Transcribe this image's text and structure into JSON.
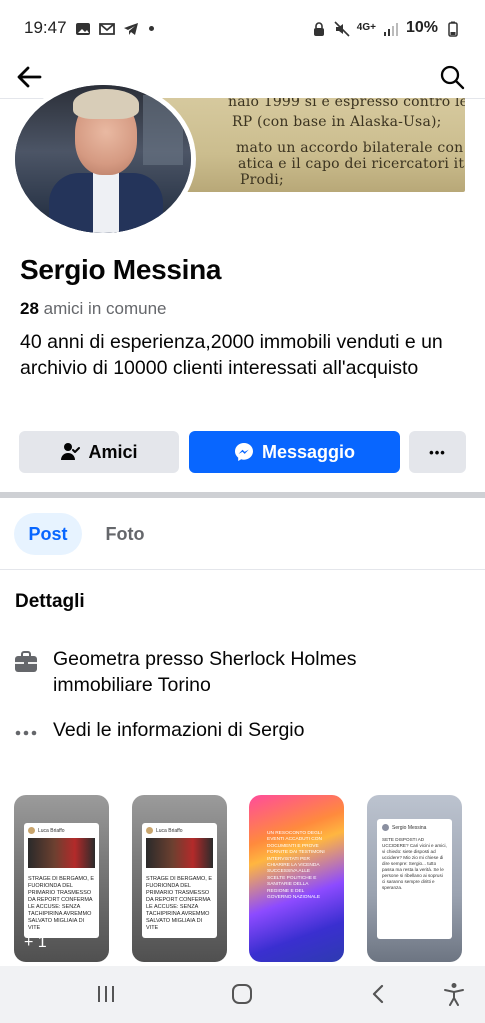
{
  "status_bar": {
    "time": "19:47",
    "network": "4G+",
    "battery": "10%"
  },
  "cover": {
    "lines": [
      "naio 1999 si è espresso contro le",
      "RP (con base in Alaska-Usa);",
      "mato un accordo bilaterale con gli",
      "atica e il capo dei ricercatori italiani",
      "Prodi;"
    ]
  },
  "profile": {
    "name": "Sergio Messina",
    "mutual_count": "28",
    "mutual_label": "amici in comune",
    "bio": "40 anni di esperienza,2000 immobili venduti e un archivio di 10000 clienti interessati all'acquisto"
  },
  "actions": {
    "friends_label": "Amici",
    "message_label": "Messaggio",
    "more_label": "•••"
  },
  "tabs": {
    "post": "Post",
    "photos": "Foto"
  },
  "details": {
    "title": "Dettagli",
    "work": "Geometra presso Sherlock Holmes immobiliare Torino",
    "info": "Vedi le informazioni di Sergio"
  },
  "thumbnails": {
    "card_author": "Luca Briaffo",
    "card_text": "STRAGE DI BERGAMO, E FUORIONDA DEL PRIMARIO TRASMESSO DA REPORT CONFERMA LE ACCUSE: SENZA TACHIPIRINA AVREMMO SALVATO MIGLIAIA DI VITE",
    "plus_more": "+ 1",
    "colorful_text": "UN RESOCONTO DEGLI EVENTI ACCADUTI CON DOCUMENTI E PROVE FORNITE DAI TESTIMONI INTERVISTATI PER CHIARIRE LA VICENDA SUCCESSIVA ALLE SCELTE POLITICHE E SANITARIE DELLA REGIONE E DEL GOVERNO NAZIONALE",
    "note_author": "Sergio Messina",
    "note_text": "SETE DISPOSTI AD UCCIDERE? Cari vicini e amici, vi chiedo: siete disposti ad uccidere? Mio zio mi chiese di dire sempre: Sergio... tutto passa ma resta la verità. Se le persone si ribellano ai soprusi ci saranno sempre diritti e speranza."
  },
  "icons": {
    "back": "arrow-left-icon",
    "search": "search-icon",
    "friends": "person-check-icon",
    "messenger": "messenger-icon",
    "briefcase": "briefcase-icon",
    "more": "ellipsis-icon"
  },
  "colors": {
    "primary": "#0866ff",
    "tab_active_bg": "#e7f3ff",
    "secondary_btn": "#e4e6eb"
  }
}
